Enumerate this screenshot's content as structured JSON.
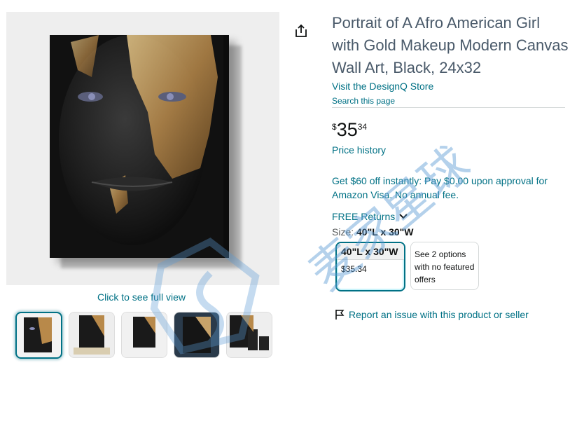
{
  "gallery": {
    "click_full_view": "Click to see full view",
    "thumbnails": [
      {
        "label": "image-1",
        "selected": true
      },
      {
        "label": "image-2",
        "selected": false
      },
      {
        "label": "image-3",
        "selected": false
      },
      {
        "label": "image-4",
        "selected": false
      },
      {
        "label": "image-5",
        "selected": false
      }
    ]
  },
  "product": {
    "title": "Portrait of A Afro American Girl with Gold Makeup Modern Canvas Wall Art, Black, 24x32",
    "store_link": "Visit the DesignQ Store",
    "search_page": "Search this page",
    "price": {
      "symbol": "$",
      "whole": "35",
      "fraction": "34"
    },
    "price_history": "Price history",
    "promo": "Get $60 off instantly: Pay $0.00 upon approval for Amazon Visa. No annual fee.",
    "returns": "FREE Returns",
    "size_label": "Size:",
    "size_value": "40\"L x 30\"W",
    "options": [
      {
        "name": "40\"L x 30\"W",
        "price": "$35.34"
      },
      {
        "text": "See 2 options with no featured offers"
      }
    ],
    "report": "Report an issue with this product or seller"
  },
  "watermark": {
    "text": "麦家星球"
  },
  "colors": {
    "link": "#007185",
    "text": "#0F1111",
    "accent_selected": "#007185",
    "watermark": "#5b9bd5"
  }
}
